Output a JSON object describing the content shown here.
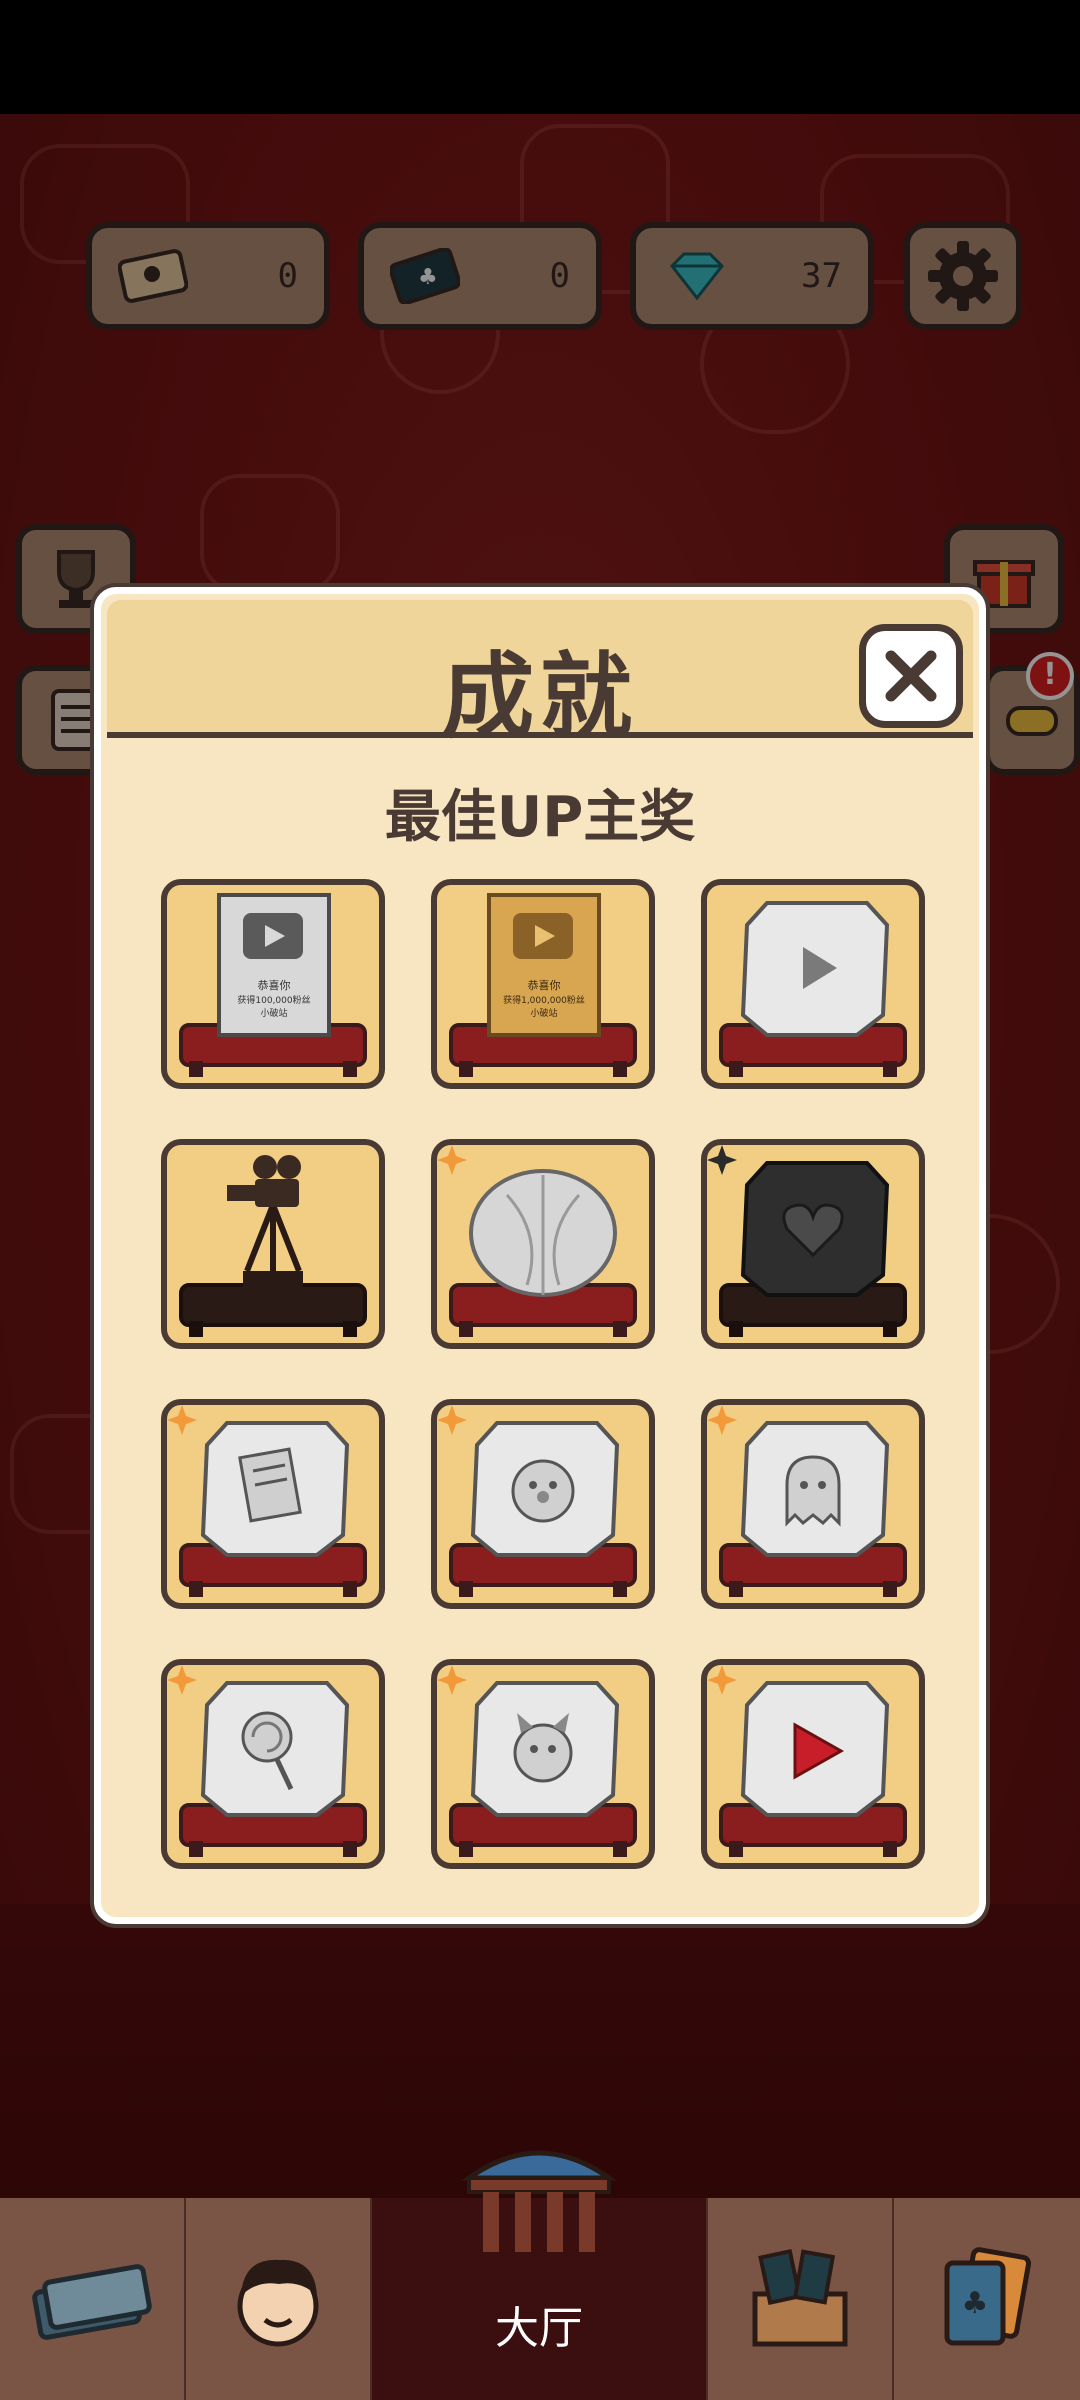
{
  "currencies": [
    {
      "name": "ticket",
      "value": "0",
      "icon": "ticket-icon"
    },
    {
      "name": "card-ticket",
      "value": "0",
      "icon": "card-ticket-icon"
    },
    {
      "name": "diamond",
      "value": "37",
      "icon": "diamond-icon"
    }
  ],
  "settings_icon": "gear-icon",
  "alert_badge": "!",
  "modal": {
    "title": "成就",
    "section_title": "最佳UP主奖",
    "close_icon": "close-icon",
    "badges": [
      {
        "type": "silver-plaque",
        "locked": false,
        "plaque_text": [
          "恭喜你",
          "获得100,000粉丝",
          "小破站"
        ]
      },
      {
        "type": "gold-plaque",
        "locked": false,
        "plaque_text": [
          "恭喜你",
          "获得1,000,000粉丝",
          "小破站"
        ]
      },
      {
        "type": "diamond-play",
        "locked": false
      },
      {
        "type": "camera-trophy",
        "locked": false
      },
      {
        "type": "cabbage",
        "locked": true
      },
      {
        "type": "black-heart",
        "locked": true
      },
      {
        "type": "script",
        "locked": true
      },
      {
        "type": "clown",
        "locked": true
      },
      {
        "type": "ghost",
        "locked": true
      },
      {
        "type": "lollipop",
        "locked": true
      },
      {
        "type": "devil",
        "locked": true
      },
      {
        "type": "red-play",
        "locked": true
      }
    ]
  },
  "nav": {
    "tabs": [
      {
        "name": "money",
        "icon": "cash-stack-icon",
        "label": ""
      },
      {
        "name": "character",
        "icon": "character-face-icon",
        "label": ""
      },
      {
        "name": "lobby",
        "icon": "theater-icon",
        "label": "大厅"
      },
      {
        "name": "cards-box",
        "icon": "card-box-icon",
        "label": ""
      },
      {
        "name": "card-pack",
        "icon": "card-pack-icon",
        "label": ""
      }
    ]
  },
  "colors": {
    "modal_bg": "#f8e6c2",
    "header_bg": "#f0d59a",
    "badge_bg": "#f2cd84",
    "outline": "#4a3a34",
    "cushion": "#8a1d1d",
    "background": "#7a1515"
  }
}
